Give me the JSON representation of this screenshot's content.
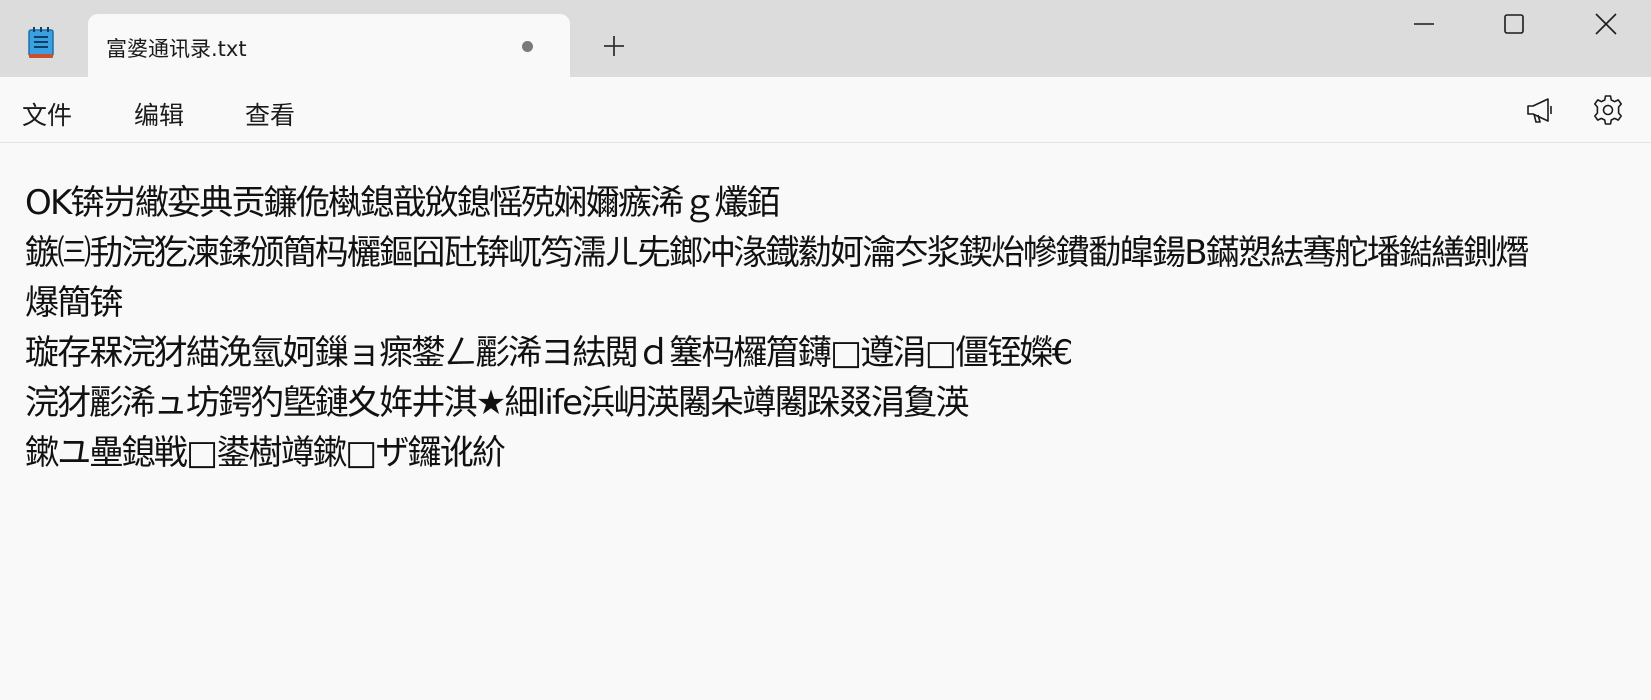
{
  "tab": {
    "title": "富婆通讯录.txt",
    "unsaved_indicator": "modified-dot"
  },
  "titlebar": {
    "app_icon": "notepad-icon",
    "new_tab_icon": "plus-icon",
    "window_controls": [
      "minimize-icon",
      "maximize-icon",
      "close-icon"
    ]
  },
  "menu": {
    "file": "文件",
    "edit": "编辑",
    "view": "查看"
  },
  "toolbar": {
    "announce_icon": "megaphone-icon",
    "settings_icon": "gear-icon"
  },
  "editor": {
    "lines": [
      "OK锛岃繖娈典贡鐮佹槸鎴戠敓鎴愮殑娴嬭瘯浠ｇ爜銆",
      "鏃㈢劧浣犵湅鍒颁簡杩欐鏂囧瓧锛屼笉濡ㄦ兂鎯冲湪鐡勬妸瀹冭浆鍥炲幓鐨勫皡鍚B鏋愬紶骞舵墦鐑繕鍘熸",
      "爆簡锛",
      "璇存槑浣犲緢浼氫妸鏁ョ瘝鐢ㄥ彲浠ヨ紶閲ｄ簺杩欏篃鑮□遵涓□僵铚嬫€",
      "浣犲彲浠ュ坊鍔犳墍鏈夊姩井淇★細life浜岄渶闂朵竴闂跺叕涓夐渶",
      "鏉ユ壘鎴戦□鍙樹竴鏉□ザ鑼讹紒"
    ]
  }
}
